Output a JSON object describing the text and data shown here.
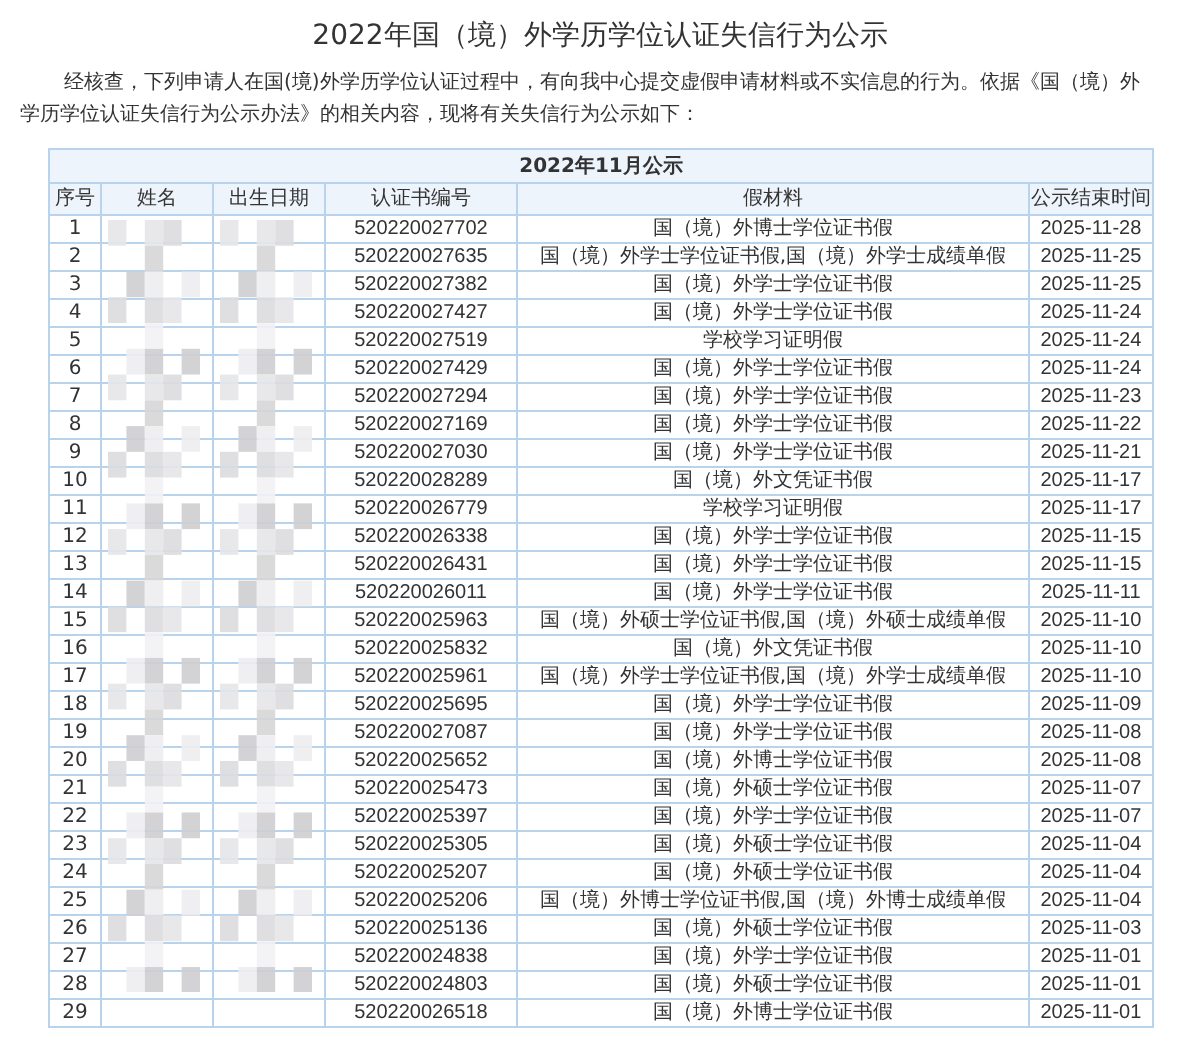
{
  "title": "2022年国（境）外学历学位认证失信行为公示",
  "intro": "经核查，下列申请人在国(境)外学历学位认证过程中，有向我中心提交虚假申请材料或不实信息的行为。依据《国（境）外学历学位认证失信行为公示办法》的相关内容，现将有关失信行为公示如下：",
  "table": {
    "caption": "2022年11月公示",
    "columns": [
      "序号",
      "姓名",
      "出生日期",
      "认证书编号",
      "假材料",
      "公示结束时间"
    ],
    "rows": [
      [
        "1",
        "",
        "",
        "520220027702",
        "国（境）外博士学位证书假",
        "2025-11-28"
      ],
      [
        "2",
        "",
        "",
        "520220027635",
        "国（境）外学士学位证书假,国（境）外学士成绩单假",
        "2025-11-25"
      ],
      [
        "3",
        "",
        "",
        "520220027382",
        "国（境）外学士学位证书假",
        "2025-11-25"
      ],
      [
        "4",
        "",
        "",
        "520220027427",
        "国（境）外学士学位证书假",
        "2025-11-24"
      ],
      [
        "5",
        "",
        "",
        "520220027519",
        "学校学习证明假",
        "2025-11-24"
      ],
      [
        "6",
        "",
        "",
        "520220027429",
        "国（境）外学士学位证书假",
        "2025-11-24"
      ],
      [
        "7",
        "",
        "",
        "520220027294",
        "国（境）外学士学位证书假",
        "2025-11-23"
      ],
      [
        "8",
        "",
        "",
        "520220027169",
        "国（境）外学士学位证书假",
        "2025-11-22"
      ],
      [
        "9",
        "",
        "",
        "520220027030",
        "国（境）外学士学位证书假",
        "2025-11-21"
      ],
      [
        "10",
        "",
        "",
        "520220028289",
        "国（境）外文凭证书假",
        "2025-11-17"
      ],
      [
        "11",
        "",
        "",
        "520220026779",
        "学校学习证明假",
        "2025-11-17"
      ],
      [
        "12",
        "",
        "",
        "520220026338",
        "国（境）外学士学位证书假",
        "2025-11-15"
      ],
      [
        "13",
        "",
        "",
        "520220026431",
        "国（境）外学士学位证书假",
        "2025-11-15"
      ],
      [
        "14",
        "",
        "",
        "520220026011",
        "国（境）外学士学位证书假",
        "2025-11-11"
      ],
      [
        "15",
        "",
        "",
        "520220025963",
        "国（境）外硕士学位证书假,国（境）外硕士成绩单假",
        "2025-11-10"
      ],
      [
        "16",
        "",
        "",
        "520220025832",
        "国（境）外文凭证书假",
        "2025-11-10"
      ],
      [
        "17",
        "",
        "",
        "520220025961",
        "国（境）外学士学位证书假,国（境）外学士成绩单假",
        "2025-11-10"
      ],
      [
        "18",
        "",
        "",
        "520220025695",
        "国（境）外学士学位证书假",
        "2025-11-09"
      ],
      [
        "19",
        "",
        "",
        "520220027087",
        "国（境）外学士学位证书假",
        "2025-11-08"
      ],
      [
        "20",
        "",
        "",
        "520220025652",
        "国（境）外博士学位证书假",
        "2025-11-08"
      ],
      [
        "21",
        "",
        "",
        "520220025473",
        "国（境）外硕士学位证书假",
        "2025-11-07"
      ],
      [
        "22",
        "",
        "",
        "520220025397",
        "国（境）外学士学位证书假",
        "2025-11-07"
      ],
      [
        "23",
        "",
        "",
        "520220025305",
        "国（境）外硕士学位证书假",
        "2025-11-04"
      ],
      [
        "24",
        "",
        "",
        "520220025207",
        "国（境）外硕士学位证书假",
        "2025-11-04"
      ],
      [
        "25",
        "",
        "",
        "520220025206",
        "国（境）外博士学位证书假,国（境）外博士成绩单假",
        "2025-11-04"
      ],
      [
        "26",
        "",
        "",
        "520220025136",
        "国（境）外硕士学位证书假",
        "2025-11-03"
      ],
      [
        "27",
        "",
        "",
        "520220024838",
        "国（境）外学士学位证书假",
        "2025-11-01"
      ],
      [
        "28",
        "",
        "",
        "520220024803",
        "国（境）外硕士学位证书假",
        "2025-11-01"
      ],
      [
        "29",
        "",
        "",
        "520220026518",
        "国（境）外博士学位证书假",
        "2025-11-01"
      ]
    ]
  }
}
